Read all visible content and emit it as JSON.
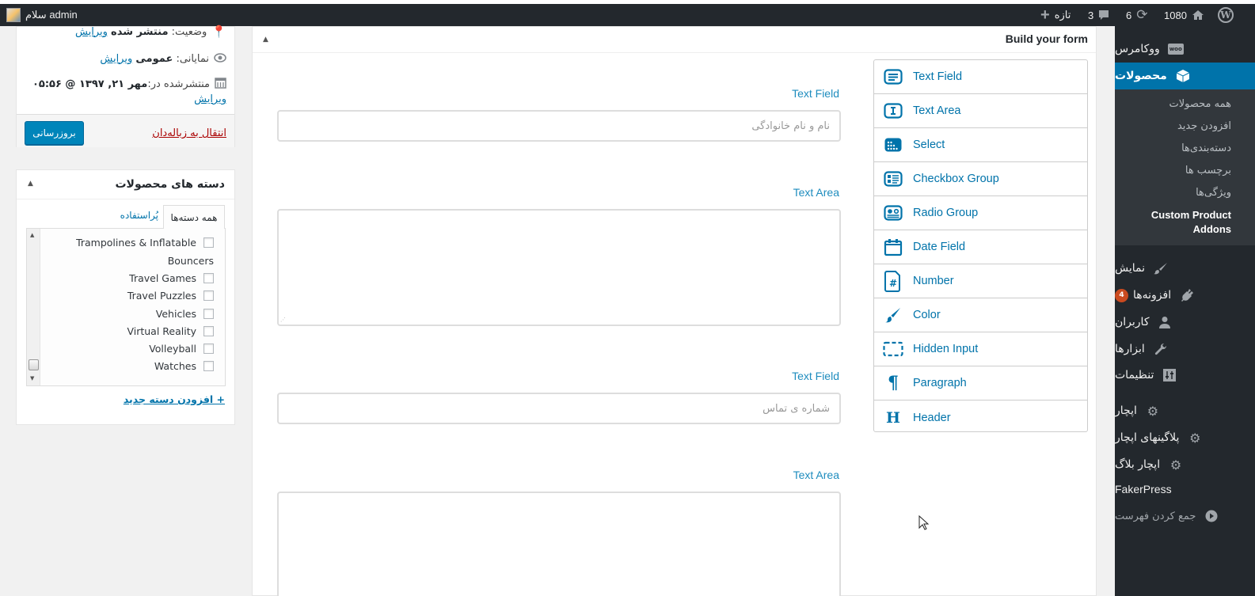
{
  "admin_bar": {
    "greeting": "سلام admin",
    "home_count": "1080",
    "updates_count": "6",
    "comments_count": "3",
    "new_label": "تازه"
  },
  "admin_menu": {
    "items_top": [
      {
        "label": "ووکامرس",
        "icon": "woo-icon"
      },
      {
        "label": "محصولات",
        "icon": "box-icon",
        "active": true
      }
    ],
    "submenu": [
      {
        "label": "همه محصولات"
      },
      {
        "label": "افزودن جدید"
      },
      {
        "label": "دسته‌بندی‌ها"
      },
      {
        "label": "برچسب ها"
      },
      {
        "label": "ویژگی‌ها"
      },
      {
        "label": "Custom Product Addons",
        "current": true
      }
    ],
    "items_bottom": [
      {
        "label": "نمایش",
        "icon": "brush-icon"
      },
      {
        "label": "افزونه‌ها",
        "icon": "plugin-icon",
        "badge": "4"
      },
      {
        "label": "کاربران",
        "icon": "user-icon"
      },
      {
        "label": "ابزارها",
        "icon": "wrench-icon"
      },
      {
        "label": "تنظیمات",
        "icon": "settings-icon"
      },
      {
        "label": "اپچار",
        "icon": "gear-icon"
      },
      {
        "label": "پلاگینهای اپچار",
        "icon": "gear-icon"
      },
      {
        "label": "اپچار بلاگ",
        "icon": "gear-icon"
      },
      {
        "label": "FakerPress",
        "icon": ""
      },
      {
        "label": "جمع کردن فهرست",
        "icon": "collapse-icon"
      }
    ]
  },
  "publish_box": {
    "status_label": "وضعیت:",
    "status_value": "منتشر شده",
    "visibility_label": "نمایانی:",
    "visibility_value": "عمومی",
    "published_label": "منتشرشده در:",
    "published_value": "مهر ۲۱, ۱۳۹۷ @ ۰۵:۵۶",
    "edit_link": "ویرایش",
    "trash_link": "انتقال به زباله‌دان",
    "update_button": "بروزرسانی"
  },
  "categories_box": {
    "title": "دسته های محصولات",
    "tab_all": "همه دسته‌ها",
    "tab_popular": "پُراستفاده",
    "items": [
      {
        "label": "Trampolines & Inflatable",
        "checked": false
      },
      {
        "label": "Bouncers",
        "continuation": true
      },
      {
        "label": "Travel Games",
        "checked": false
      },
      {
        "label": "Travel Puzzles",
        "checked": false
      },
      {
        "label": "Vehicles",
        "checked": false
      },
      {
        "label": "Virtual Reality",
        "checked": false
      },
      {
        "label": "Volleyball",
        "checked": false
      },
      {
        "label": "Watches",
        "checked": false
      }
    ],
    "add_new": "+ افزودن دسته جدید"
  },
  "builder": {
    "title": "Build your form",
    "fields": [
      {
        "type": "text",
        "label": "Text Field",
        "placeholder": "نام و نام خانوادگی"
      },
      {
        "type": "textarea",
        "label": "Text Area"
      },
      {
        "type": "text",
        "label": "Text Field",
        "placeholder": "شماره ی تماس"
      },
      {
        "type": "textarea",
        "label": "Text Area"
      }
    ],
    "palette": [
      {
        "label": "Text Field",
        "icon": "text-field-icon"
      },
      {
        "label": "Text Area",
        "icon": "text-area-icon"
      },
      {
        "label": "Select",
        "icon": "select-icon"
      },
      {
        "label": "Checkbox Group",
        "icon": "checkbox-group-icon"
      },
      {
        "label": "Radio Group",
        "icon": "radio-group-icon"
      },
      {
        "label": "Date Field",
        "icon": "calendar-icon"
      },
      {
        "label": "Number",
        "icon": "number-icon"
      },
      {
        "label": "Color",
        "icon": "brush-icon"
      },
      {
        "label": "Hidden Input",
        "icon": "hidden-input-icon"
      },
      {
        "label": "Paragraph",
        "icon": "paragraph-icon"
      },
      {
        "label": "Header",
        "icon": "header-icon"
      }
    ]
  },
  "colors": {
    "admin_bg": "#23282d",
    "accent": "#0073aa",
    "field_label": "#1e8cbe",
    "trash": "#a00000",
    "badge": "#ca4a1f"
  }
}
